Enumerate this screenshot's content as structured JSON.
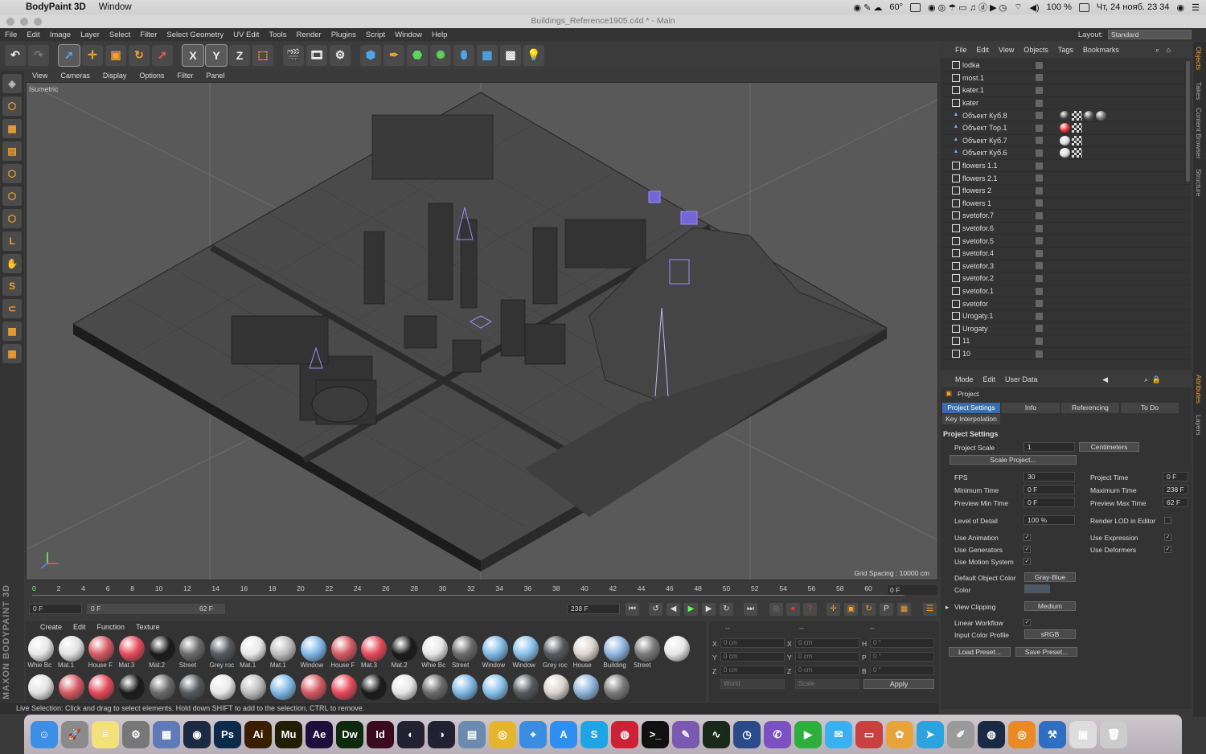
{
  "mac_menubar": {
    "app_name": "BodyPaint 3D",
    "menu_item": "Window",
    "right_status": {
      "temperature": "60°",
      "battery": "100 %",
      "datetime": "Чт, 24 нояб.  23 34"
    }
  },
  "window": {
    "title": "Buildings_Reference1905.c4d * - Main"
  },
  "app_menu": {
    "items": [
      "File",
      "Edit",
      "Image",
      "Layer",
      "Select",
      "Filter",
      "Select Geometry",
      "UV Edit",
      "Tools",
      "Render",
      "Plugins",
      "Script",
      "Window",
      "Help"
    ],
    "layout_label": "Layout:",
    "layout_value": "Standard"
  },
  "toolbar": {
    "axis_x": "X",
    "axis_y": "Y",
    "axis_z": "Z"
  },
  "viewport": {
    "menu": [
      "View",
      "Cameras",
      "Display",
      "Options",
      "Filter",
      "Panel"
    ],
    "projection": "Isometric",
    "grid_spacing": "Grid Spacing : 10000 cm"
  },
  "timeline": {
    "ticks": [
      "0",
      "2",
      "4",
      "6",
      "8",
      "10",
      "12",
      "14",
      "16",
      "18",
      "20",
      "22",
      "24",
      "26",
      "28",
      "30",
      "32",
      "34",
      "36",
      "38",
      "40",
      "42",
      "44",
      "46",
      "48",
      "50",
      "52",
      "54",
      "56",
      "58",
      "60",
      "62"
    ],
    "current_frame": "0 F"
  },
  "playback": {
    "start_field": "0 F",
    "range_min": "0 F",
    "range_max": "62 F",
    "end_field": "238 F"
  },
  "material_manager": {
    "menu": [
      "Create",
      "Edit",
      "Function",
      "Texture"
    ],
    "materials": [
      {
        "label": "Whie Bc",
        "color": "#e6e6e6"
      },
      {
        "label": "Mat.1",
        "color": "#e2e2e2"
      },
      {
        "label": "House F",
        "color": "#d45a62"
      },
      {
        "label": "Mat.3",
        "color": "#e54a5a"
      },
      {
        "label": "Mat.2",
        "color": "#1a1a1a"
      },
      {
        "label": "Street",
        "color": "#6a6a6a"
      },
      {
        "label": "Grey roc",
        "color": "#55595e"
      },
      {
        "label": "Mat.1",
        "color": "#e8e8e8"
      },
      {
        "label": "Mat.1",
        "color": "#bcbcbc"
      },
      {
        "label": "Window",
        "color": "#7fb8e4"
      },
      {
        "label": "House F",
        "color": "#d45a62"
      },
      {
        "label": "Mat.3",
        "color": "#e54a5a"
      },
      {
        "label": "Mat.2",
        "color": "#1a1a1a"
      },
      {
        "label": "Whie Bc",
        "color": "#e6e6e6"
      },
      {
        "label": "Street",
        "color": "#6a6a6a"
      },
      {
        "label": "Window",
        "color": "#7fb8e4"
      },
      {
        "label": "Window",
        "color": "#88c1ea"
      },
      {
        "label": "Grey roc",
        "color": "#55595e"
      },
      {
        "label": "House",
        "color": "#d9d4cc"
      },
      {
        "label": "Building",
        "color": "#8fb4dc"
      },
      {
        "label": "Street",
        "color": "#7a7a7a"
      }
    ]
  },
  "coordinates": {
    "pos_header": "--",
    "size_header": "--",
    "rot_header": "--",
    "rows": [
      {
        "a": "X",
        "av": "0 cm",
        "b": "X",
        "bv": "0 cm",
        "c": "H",
        "cv": "0 °"
      },
      {
        "a": "Y",
        "av": "0 cm",
        "b": "Y",
        "bv": "0 cm",
        "c": "P",
        "cv": "0 °"
      },
      {
        "a": "Z",
        "av": "0 cm",
        "b": "Z",
        "bv": "0 cm",
        "c": "B",
        "cv": "0 °"
      }
    ],
    "space": "World",
    "mode": "Scale",
    "apply_label": "Apply"
  },
  "status_bar": {
    "text": "Live Selection: Click and drag to select elements. Hold down SHIFT to add to the selection, CTRL to remove."
  },
  "object_manager": {
    "menu": [
      "File",
      "Edit",
      "View",
      "Objects",
      "Tags",
      "Bookmarks"
    ],
    "objects": [
      {
        "name": "lodka",
        "kind": "null"
      },
      {
        "name": "most.1",
        "kind": "null"
      },
      {
        "name": "kater.1",
        "kind": "null"
      },
      {
        "name": "kater",
        "kind": "null"
      },
      {
        "name": "Объект Куб.8",
        "kind": "primitive",
        "tags": [
          "#444",
          "checker",
          "#555",
          "#777"
        ]
      },
      {
        "name": "Объект Тор.1",
        "kind": "primitive",
        "tags": [
          "#e33",
          "checker"
        ]
      },
      {
        "name": "Объект Куб.7",
        "kind": "primitive",
        "tags": [
          "#ddd",
          "checker"
        ]
      },
      {
        "name": "Объект Куб.6",
        "kind": "primitive",
        "tags": [
          "#ddd",
          "checker"
        ]
      },
      {
        "name": "flowers 1.1",
        "kind": "null"
      },
      {
        "name": "flowers 2.1",
        "kind": "null"
      },
      {
        "name": "flowers 2",
        "kind": "null"
      },
      {
        "name": "flowers 1",
        "kind": "null"
      },
      {
        "name": "svetofor.7",
        "kind": "null"
      },
      {
        "name": "svetofor.6",
        "kind": "null"
      },
      {
        "name": "svetofor.5",
        "kind": "null"
      },
      {
        "name": "svetofor.4",
        "kind": "null"
      },
      {
        "name": "svetofor.3",
        "kind": "null"
      },
      {
        "name": "svetofor.2",
        "kind": "null"
      },
      {
        "name": "svetofor.1",
        "kind": "null"
      },
      {
        "name": "svetofor",
        "kind": "null"
      },
      {
        "name": "Urogaty.1",
        "kind": "null"
      },
      {
        "name": "Urogaty",
        "kind": "null"
      },
      {
        "name": "11",
        "kind": "null"
      },
      {
        "name": "10",
        "kind": "null"
      }
    ]
  },
  "side_tabs": [
    "Objects",
    "Takes",
    "Content Browser",
    "Structure",
    "Attributes",
    "Layers"
  ],
  "attributes": {
    "menu": [
      "Mode",
      "Edit",
      "User Data"
    ],
    "object_label": "Project",
    "tabs": [
      "Project Settings",
      "Info",
      "Referencing",
      "To Do"
    ],
    "sub_tab": "Key Interpolation",
    "section_title": "Project Settings",
    "project_scale_label": "Project Scale",
    "project_scale_value": "1",
    "project_scale_unit": "Centimeters",
    "scale_project_btn": "Scale Project...",
    "fps_label": "FPS",
    "fps_value": "30",
    "project_time_label": "Project Time",
    "project_time_value": "0 F",
    "min_time_label": "Minimum Time",
    "min_time_value": "0 F",
    "max_time_label": "Maximum Time",
    "max_time_value": "238 F",
    "prev_min_label": "Preview Min Time",
    "prev_min_value": "0 F",
    "prev_max_label": "Preview Max Time",
    "prev_max_value": "62 F",
    "lod_label": "Level of Detail",
    "lod_value": "100 %",
    "render_lod_label": "Render LOD in Editor",
    "use_animation_label": "Use Animation",
    "use_expression_label": "Use Expression",
    "use_generators_label": "Use Generators",
    "use_deformers_label": "Use Deformers",
    "use_motion_label": "Use Motion System",
    "default_color_label": "Default Object Color",
    "default_color_value": "Gray-Blue",
    "color_label": "Color",
    "view_clipping_label": "View Clipping",
    "view_clipping_value": "Medium",
    "linear_workflow_label": "Linear Workflow",
    "input_profile_label": "Input Color Profile",
    "input_profile_value": "sRGB",
    "load_preset_btn": "Load Preset...",
    "save_preset_btn": "Save Preset..."
  },
  "dock": {
    "apps": [
      {
        "name": "finder-icon",
        "glyph": "☺",
        "color": "#3d8ee6"
      },
      {
        "name": "launchpad-icon",
        "glyph": "🚀",
        "color": "#8a8a8a"
      },
      {
        "name": "notes-icon",
        "glyph": "≡",
        "color": "#f3e27a"
      },
      {
        "name": "system-preferences-icon",
        "glyph": "⚙",
        "color": "#777"
      },
      {
        "name": "photos-app-icon",
        "glyph": "▦",
        "color": "#5f7ab8"
      },
      {
        "name": "cinema4d-icon",
        "glyph": "◉",
        "color": "#1b2b44"
      },
      {
        "name": "photoshop-icon",
        "glyph": "Ps",
        "color": "#0a2b4a"
      },
      {
        "name": "illustrator-icon",
        "glyph": "Ai",
        "color": "#3a1e00"
      },
      {
        "name": "muse-icon",
        "glyph": "Mu",
        "color": "#1f1f06"
      },
      {
        "name": "after-effects-icon",
        "glyph": "Ae",
        "color": "#1c0f3a"
      },
      {
        "name": "dreamweaver-icon",
        "glyph": "Dw",
        "color": "#0d2a0d"
      },
      {
        "name": "indesign-icon",
        "glyph": "Id",
        "color": "#3a0a1e"
      },
      {
        "name": "c4d-r19-icon",
        "glyph": "◐",
        "color": "#223"
      },
      {
        "name": "c4d-r20-icon",
        "glyph": "◑",
        "color": "#223"
      },
      {
        "name": "image-capture-icon",
        "glyph": "▤",
        "color": "#6a8ab0"
      },
      {
        "name": "chrome-icon",
        "glyph": "◎",
        "color": "#e6b530"
      },
      {
        "name": "safari-icon",
        "glyph": "⌖",
        "color": "#3a8de0"
      },
      {
        "name": "app-store-icon",
        "glyph": "A",
        "color": "#2f8ff0"
      },
      {
        "name": "skype-icon",
        "glyph": "S",
        "color": "#1fa4e6"
      },
      {
        "name": "photo-booth-icon",
        "glyph": "◍",
        "color": "#c23"
      },
      {
        "name": "terminal-icon",
        "glyph": ">_",
        "color": "#111"
      },
      {
        "name": "quill-icon",
        "glyph": "✎",
        "color": "#7a5ab0"
      },
      {
        "name": "activity-monitor-icon",
        "glyph": "∿",
        "color": "#1a2a1a"
      },
      {
        "name": "gauge-icon",
        "glyph": "◷",
        "color": "#2a4a8a"
      },
      {
        "name": "viber-icon",
        "glyph": "✆",
        "color": "#7b51c2"
      },
      {
        "name": "facetime-icon",
        "glyph": "▶",
        "color": "#2fae3c"
      },
      {
        "name": "messages-icon",
        "glyph": "✉",
        "color": "#3ab0f0"
      },
      {
        "name": "presentation-icon",
        "glyph": "▭",
        "color": "#c94040"
      },
      {
        "name": "photos-icon",
        "glyph": "✿",
        "color": "#e8a33a"
      },
      {
        "name": "telegram-icon",
        "glyph": "➤",
        "color": "#2aa3df"
      },
      {
        "name": "script-editor-icon",
        "glyph": "✐",
        "color": "#9a9a9a"
      },
      {
        "name": "steam-icon",
        "glyph": "◍",
        "color": "#1a2a44"
      },
      {
        "name": "blender-icon",
        "glyph": "◎",
        "color": "#ea8a25"
      },
      {
        "name": "xcode-icon",
        "glyph": "⚒",
        "color": "#2f6fc2"
      },
      {
        "name": "preview-icon",
        "glyph": "▣",
        "color": "#ddd"
      },
      {
        "name": "trash-icon",
        "glyph": "🗑",
        "color": "#ccc"
      }
    ]
  }
}
